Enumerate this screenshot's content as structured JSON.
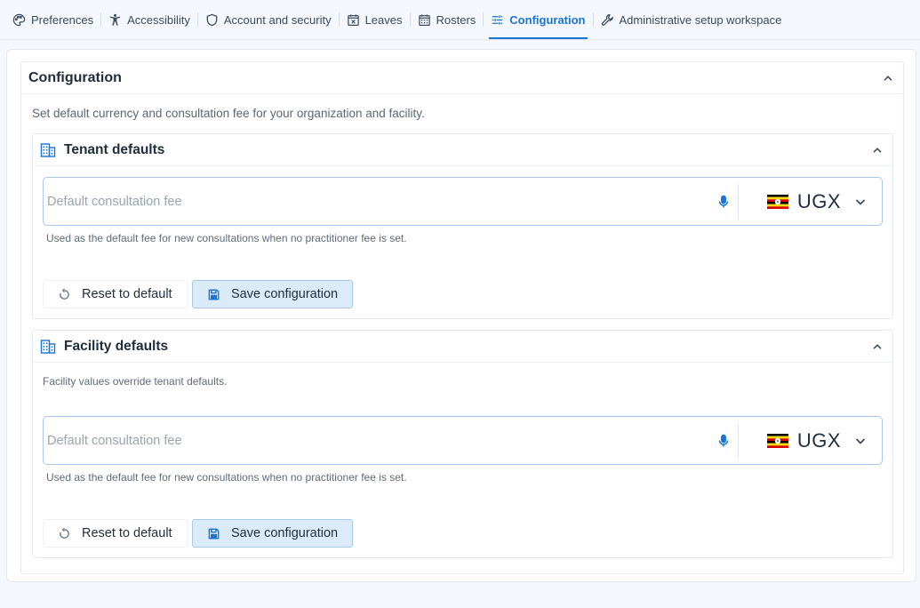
{
  "tabs": [
    {
      "label": "Preferences",
      "icon": "palette-icon",
      "active": false
    },
    {
      "label": "Accessibility",
      "icon": "accessibility-icon",
      "active": false
    },
    {
      "label": "Account and security",
      "icon": "shield-icon",
      "active": false
    },
    {
      "label": "Leaves",
      "icon": "calendar-x-icon",
      "active": false
    },
    {
      "label": "Rosters",
      "icon": "calendar-grid-icon",
      "active": false
    },
    {
      "label": "Configuration",
      "icon": "sliders-icon",
      "active": true
    },
    {
      "label": "Administrative setup workspace",
      "icon": "wrench-icon",
      "active": false
    }
  ],
  "config": {
    "title": "Configuration",
    "description": "Set default currency and consultation fee for your organization and facility.",
    "tenant": {
      "title": "Tenant defaults",
      "fee_placeholder": "Default consultation fee",
      "fee_value": "",
      "currency": "UGX",
      "hint": "Used as the default fee for new consultations when no practitioner fee is set.",
      "reset_label": "Reset to default",
      "save_label": "Save configuration"
    },
    "facility": {
      "title": "Facility defaults",
      "note": "Facility values override tenant defaults.",
      "fee_placeholder": "Default consultation fee",
      "fee_value": "",
      "currency": "UGX",
      "hint": "Used as the default fee for new consultations when no practitioner fee is set.",
      "reset_label": "Reset to default",
      "save_label": "Save configuration"
    }
  },
  "colors": {
    "accent": "#1b73d6",
    "field_border": "#a9c8ec",
    "save_bg": "#dcebfa"
  }
}
